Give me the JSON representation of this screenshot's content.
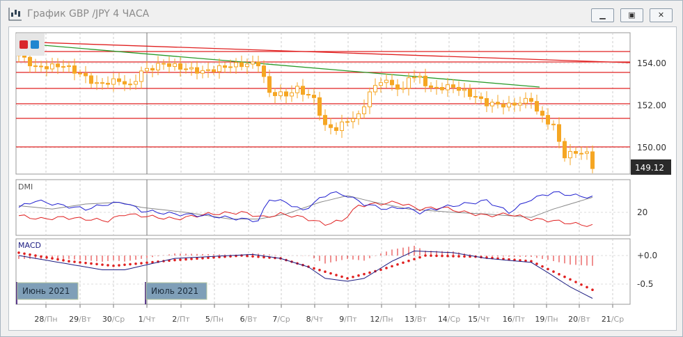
{
  "window": {
    "title": "График GBP /JPY  4 ЧАСА",
    "buttons": [
      "minimize",
      "maximize",
      "close"
    ]
  },
  "chart": {
    "symbol": "GBP/JPY",
    "timeframe": "4 ЧАСА",
    "price_axis": [
      "154.00",
      "152.00",
      "150.00"
    ],
    "last_price": "149.12",
    "colors": {
      "up": "#f5a623",
      "line_red": "#e02020",
      "line_green": "#2a9a2a",
      "plus_di": "#2020d0",
      "minus_di": "#e02020",
      "adx": "#888888",
      "macd": "#1a1a80",
      "signal": "#e02020"
    },
    "price_keypoints": [
      [
        0,
        154.4
      ],
      [
        3,
        153.8
      ],
      [
        8,
        153.9
      ],
      [
        11,
        153.5
      ],
      [
        14,
        153.0
      ],
      [
        18,
        153.2
      ],
      [
        20,
        152.9
      ],
      [
        22,
        153.6
      ],
      [
        26,
        154.0
      ],
      [
        29,
        153.8
      ],
      [
        33,
        153.6
      ],
      [
        38,
        153.9
      ],
      [
        43,
        154.0
      ],
      [
        45,
        152.6
      ],
      [
        48,
        152.5
      ],
      [
        50,
        152.8
      ],
      [
        53,
        152.3
      ],
      [
        55,
        151.0
      ],
      [
        57,
        150.9
      ],
      [
        59,
        151.3
      ],
      [
        61,
        151.5
      ],
      [
        63,
        152.6
      ],
      [
        65,
        153.2
      ],
      [
        67,
        153.0
      ],
      [
        69,
        152.7
      ],
      [
        70,
        153.4
      ],
      [
        72,
        153.3
      ],
      [
        74,
        152.8
      ],
      [
        78,
        152.9
      ],
      [
        82,
        152.4
      ],
      [
        84,
        152.1
      ],
      [
        88,
        152.0
      ],
      [
        92,
        152.3
      ],
      [
        93,
        151.7
      ],
      [
        96,
        151.0
      ],
      [
        98,
        149.6
      ],
      [
        100,
        149.8
      ],
      [
        102,
        149.7
      ],
      [
        103,
        149.12
      ]
    ],
    "dmi": {
      "label": "DMI",
      "level": "20",
      "plus_di": [
        [
          0,
          23
        ],
        [
          3,
          27
        ],
        [
          8,
          24
        ],
        [
          12,
          22
        ],
        [
          16,
          25
        ],
        [
          19,
          26
        ],
        [
          22,
          21
        ],
        [
          28,
          19
        ],
        [
          34,
          18
        ],
        [
          40,
          16
        ],
        [
          43,
          15
        ],
        [
          45,
          28
        ],
        [
          48,
          26
        ],
        [
          51,
          21
        ],
        [
          54,
          28
        ],
        [
          56,
          32
        ],
        [
          59,
          30
        ],
        [
          62,
          25
        ],
        [
          66,
          22
        ],
        [
          69,
          23
        ],
        [
          72,
          20
        ],
        [
          76,
          23
        ],
        [
          80,
          25
        ],
        [
          84,
          27
        ],
        [
          88,
          20
        ],
        [
          92,
          28
        ],
        [
          96,
          32
        ],
        [
          100,
          30
        ],
        [
          103,
          29
        ]
      ],
      "minus_di": [
        [
          0,
          18
        ],
        [
          4,
          16
        ],
        [
          8,
          17
        ],
        [
          12,
          16
        ],
        [
          16,
          15
        ],
        [
          19,
          19
        ],
        [
          22,
          18
        ],
        [
          28,
          16
        ],
        [
          34,
          19
        ],
        [
          40,
          20
        ],
        [
          44,
          17
        ],
        [
          47,
          19
        ],
        [
          51,
          17
        ],
        [
          55,
          13
        ],
        [
          58,
          15
        ],
        [
          61,
          24
        ],
        [
          64,
          25
        ],
        [
          68,
          26
        ],
        [
          72,
          22
        ],
        [
          76,
          23
        ],
        [
          80,
          20
        ],
        [
          84,
          18
        ],
        [
          88,
          19
        ],
        [
          92,
          16
        ],
        [
          96,
          15
        ],
        [
          100,
          13
        ],
        [
          103,
          12
        ]
      ],
      "adx": [
        [
          0,
          24
        ],
        [
          6,
          22
        ],
        [
          12,
          25
        ],
        [
          18,
          26
        ],
        [
          22,
          23
        ],
        [
          30,
          20
        ],
        [
          38,
          16
        ],
        [
          43,
          16
        ],
        [
          48,
          19
        ],
        [
          54,
          26
        ],
        [
          59,
          30
        ],
        [
          64,
          26
        ],
        [
          70,
          22
        ],
        [
          78,
          20
        ],
        [
          84,
          19
        ],
        [
          88,
          18
        ],
        [
          92,
          17
        ],
        [
          96,
          22
        ],
        [
          100,
          26
        ],
        [
          103,
          29
        ]
      ]
    },
    "macd": {
      "label": "MACD",
      "levels": [
        "+0.0",
        "-0.5"
      ],
      "line": [
        [
          0,
          0
        ],
        [
          9,
          -0.15
        ],
        [
          15,
          -0.25
        ],
        [
          19,
          -0.25
        ],
        [
          28,
          -0.05
        ],
        [
          42,
          0.02
        ],
        [
          47,
          -0.05
        ],
        [
          52,
          -0.2
        ],
        [
          55,
          -0.4
        ],
        [
          59,
          -0.45
        ],
        [
          62,
          -0.4
        ],
        [
          67,
          -0.1
        ],
        [
          71,
          0.08
        ],
        [
          78,
          0.05
        ],
        [
          84,
          -0.05
        ],
        [
          92,
          -0.12
        ],
        [
          95,
          -0.3
        ],
        [
          99,
          -0.55
        ],
        [
          103,
          -0.75
        ]
      ],
      "signal": [
        [
          0,
          0.05
        ],
        [
          9,
          -0.1
        ],
        [
          17,
          -0.18
        ],
        [
          28,
          -0.08
        ],
        [
          40,
          0
        ],
        [
          47,
          -0.05
        ],
        [
          59,
          -0.4
        ],
        [
          65,
          -0.25
        ],
        [
          73,
          0
        ],
        [
          82,
          -0.02
        ],
        [
          92,
          -0.1
        ],
        [
          103,
          -0.6
        ]
      ]
    },
    "period_labels": [
      "Июнь 2021",
      "Июль 2021"
    ],
    "x_labels": [
      [
        "28",
        "Пн"
      ],
      [
        "29",
        "Вт"
      ],
      [
        "30",
        "Ср"
      ],
      [
        "1",
        "Чт"
      ],
      [
        "2",
        "Пт"
      ],
      [
        "5",
        "Пн"
      ],
      [
        "6",
        "Вт"
      ],
      [
        "7",
        "Ср"
      ],
      [
        "8",
        "Чт"
      ],
      [
        "9",
        "Пт"
      ],
      [
        "12",
        "Пн"
      ],
      [
        "13",
        "Вт"
      ],
      [
        "14",
        "Ср"
      ],
      [
        "15",
        "Чт"
      ],
      [
        "16",
        "Пт"
      ],
      [
        "19",
        "Пн"
      ],
      [
        "20",
        "Вт"
      ],
      [
        "21",
        "Ср"
      ]
    ]
  }
}
